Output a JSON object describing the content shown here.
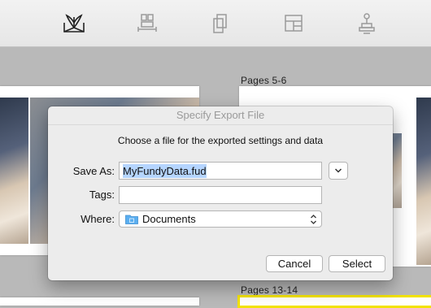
{
  "toolbar": {
    "items": [
      {
        "icon": "book-open-icon"
      },
      {
        "icon": "pages-layout-icon"
      },
      {
        "icon": "copy-pages-icon"
      },
      {
        "icon": "template-layout-icon"
      },
      {
        "icon": "stamp-icon"
      }
    ]
  },
  "workspace": {
    "labels": {
      "pages_5_6": "Pages 5-6",
      "pages_13_14": "Pages 13-14"
    }
  },
  "dialog": {
    "title": "Specify Export File",
    "message": "Choose a file for the exported settings and data",
    "save_as_label": "Save As:",
    "save_as_value": "MyFundyData.fud",
    "tags_label": "Tags:",
    "tags_value": "",
    "where_label": "Where:",
    "where_value": "Documents",
    "cancel_label": "Cancel",
    "select_label": "Select"
  },
  "colors": {
    "toolbar_bg": "#eeeeee",
    "workspace_bg": "#b9b9b9",
    "selection_highlight": "#b5d5ff",
    "selected_spread_border": "#f2e200",
    "folder_blue": "#5aaef0"
  }
}
